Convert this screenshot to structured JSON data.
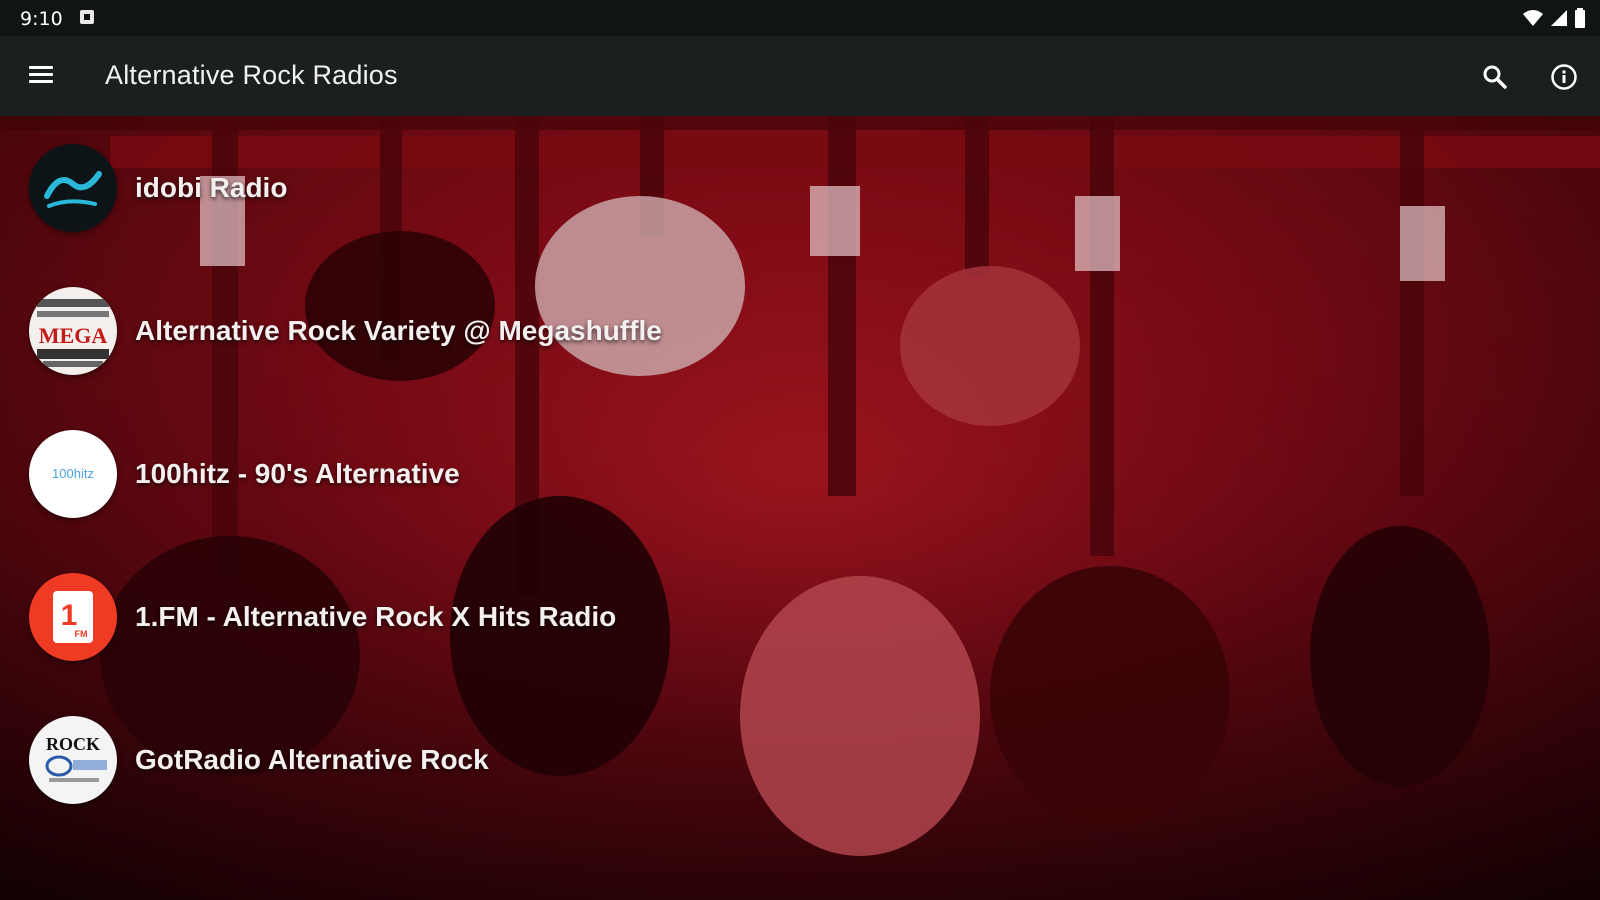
{
  "status_bar": {
    "time": "9:10",
    "icons": [
      "notification-icon",
      "wifi-icon",
      "signal-icon",
      "battery-icon"
    ]
  },
  "app_bar": {
    "title": "Alternative Rock Radios",
    "menu_icon": "hamburger-menu-icon",
    "search_icon": "search-icon",
    "info_icon": "info-icon"
  },
  "colors": {
    "status_bar": "#101414",
    "app_bar": "#1b1f1f",
    "background_tint": "#8a0d16",
    "text": "#f4f0f0"
  },
  "stations": [
    {
      "name": "idobi Radio",
      "logo": "idobi-logo"
    },
    {
      "name": "Alternative Rock Variety @ Megashuffle",
      "logo": "megashuffle-logo",
      "logo_text": "MEGA"
    },
    {
      "name": "100hitz - 90's Alternative",
      "logo": "100hitz-logo",
      "logo_text": "100hitz"
    },
    {
      "name": "1.FM - Alternative Rock X Hits Radio",
      "logo": "1fm-logo",
      "logo_text": "1"
    },
    {
      "name": "GotRadio Alternative Rock",
      "logo": "gotradio-logo",
      "logo_text": "ROCK"
    }
  ]
}
